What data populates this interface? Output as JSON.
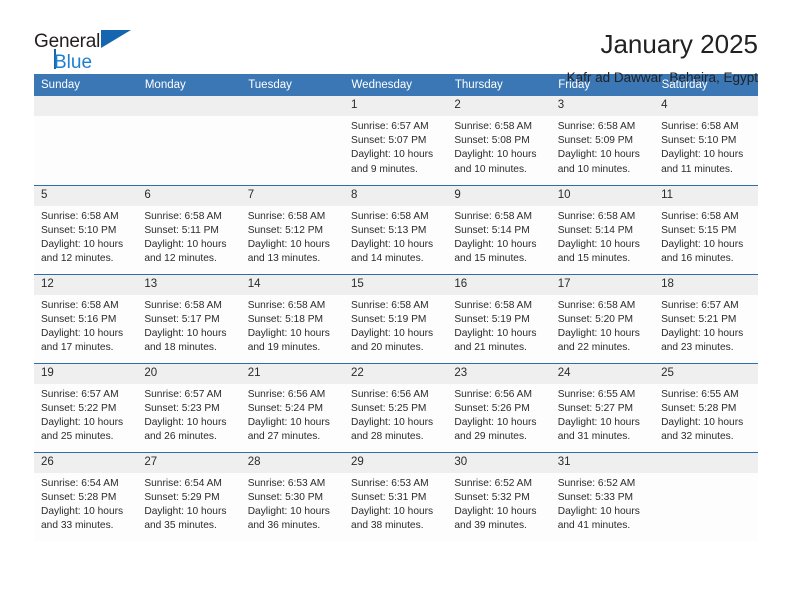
{
  "brand": {
    "line1": "General",
    "line2": "Blue",
    "triangle_color": "#1565b0",
    "blue_color": "#1d7fd0"
  },
  "header": {
    "title": "January 2025",
    "subtitle": "Kafr ad Dawwar, Beheira, Egypt",
    "header_bg": "#3b76b5",
    "daynum_bg": "#efefef"
  },
  "weekdays": [
    "Sunday",
    "Monday",
    "Tuesday",
    "Wednesday",
    "Thursday",
    "Friday",
    "Saturday"
  ],
  "weeks": [
    [
      {
        "day": "",
        "empty": true
      },
      {
        "day": "",
        "empty": true
      },
      {
        "day": "",
        "empty": true
      },
      {
        "day": "1",
        "sunrise": "Sunrise: 6:57 AM",
        "sunset": "Sunset: 5:07 PM",
        "daylight1": "Daylight: 10 hours",
        "daylight2": "and 9 minutes."
      },
      {
        "day": "2",
        "sunrise": "Sunrise: 6:58 AM",
        "sunset": "Sunset: 5:08 PM",
        "daylight1": "Daylight: 10 hours",
        "daylight2": "and 10 minutes."
      },
      {
        "day": "3",
        "sunrise": "Sunrise: 6:58 AM",
        "sunset": "Sunset: 5:09 PM",
        "daylight1": "Daylight: 10 hours",
        "daylight2": "and 10 minutes."
      },
      {
        "day": "4",
        "sunrise": "Sunrise: 6:58 AM",
        "sunset": "Sunset: 5:10 PM",
        "daylight1": "Daylight: 10 hours",
        "daylight2": "and 11 minutes."
      }
    ],
    [
      {
        "day": "5",
        "sunrise": "Sunrise: 6:58 AM",
        "sunset": "Sunset: 5:10 PM",
        "daylight1": "Daylight: 10 hours",
        "daylight2": "and 12 minutes."
      },
      {
        "day": "6",
        "sunrise": "Sunrise: 6:58 AM",
        "sunset": "Sunset: 5:11 PM",
        "daylight1": "Daylight: 10 hours",
        "daylight2": "and 12 minutes."
      },
      {
        "day": "7",
        "sunrise": "Sunrise: 6:58 AM",
        "sunset": "Sunset: 5:12 PM",
        "daylight1": "Daylight: 10 hours",
        "daylight2": "and 13 minutes."
      },
      {
        "day": "8",
        "sunrise": "Sunrise: 6:58 AM",
        "sunset": "Sunset: 5:13 PM",
        "daylight1": "Daylight: 10 hours",
        "daylight2": "and 14 minutes."
      },
      {
        "day": "9",
        "sunrise": "Sunrise: 6:58 AM",
        "sunset": "Sunset: 5:14 PM",
        "daylight1": "Daylight: 10 hours",
        "daylight2": "and 15 minutes."
      },
      {
        "day": "10",
        "sunrise": "Sunrise: 6:58 AM",
        "sunset": "Sunset: 5:14 PM",
        "daylight1": "Daylight: 10 hours",
        "daylight2": "and 15 minutes."
      },
      {
        "day": "11",
        "sunrise": "Sunrise: 6:58 AM",
        "sunset": "Sunset: 5:15 PM",
        "daylight1": "Daylight: 10 hours",
        "daylight2": "and 16 minutes."
      }
    ],
    [
      {
        "day": "12",
        "sunrise": "Sunrise: 6:58 AM",
        "sunset": "Sunset: 5:16 PM",
        "daylight1": "Daylight: 10 hours",
        "daylight2": "and 17 minutes."
      },
      {
        "day": "13",
        "sunrise": "Sunrise: 6:58 AM",
        "sunset": "Sunset: 5:17 PM",
        "daylight1": "Daylight: 10 hours",
        "daylight2": "and 18 minutes."
      },
      {
        "day": "14",
        "sunrise": "Sunrise: 6:58 AM",
        "sunset": "Sunset: 5:18 PM",
        "daylight1": "Daylight: 10 hours",
        "daylight2": "and 19 minutes."
      },
      {
        "day": "15",
        "sunrise": "Sunrise: 6:58 AM",
        "sunset": "Sunset: 5:19 PM",
        "daylight1": "Daylight: 10 hours",
        "daylight2": "and 20 minutes."
      },
      {
        "day": "16",
        "sunrise": "Sunrise: 6:58 AM",
        "sunset": "Sunset: 5:19 PM",
        "daylight1": "Daylight: 10 hours",
        "daylight2": "and 21 minutes."
      },
      {
        "day": "17",
        "sunrise": "Sunrise: 6:58 AM",
        "sunset": "Sunset: 5:20 PM",
        "daylight1": "Daylight: 10 hours",
        "daylight2": "and 22 minutes."
      },
      {
        "day": "18",
        "sunrise": "Sunrise: 6:57 AM",
        "sunset": "Sunset: 5:21 PM",
        "daylight1": "Daylight: 10 hours",
        "daylight2": "and 23 minutes."
      }
    ],
    [
      {
        "day": "19",
        "sunrise": "Sunrise: 6:57 AM",
        "sunset": "Sunset: 5:22 PM",
        "daylight1": "Daylight: 10 hours",
        "daylight2": "and 25 minutes."
      },
      {
        "day": "20",
        "sunrise": "Sunrise: 6:57 AM",
        "sunset": "Sunset: 5:23 PM",
        "daylight1": "Daylight: 10 hours",
        "daylight2": "and 26 minutes."
      },
      {
        "day": "21",
        "sunrise": "Sunrise: 6:56 AM",
        "sunset": "Sunset: 5:24 PM",
        "daylight1": "Daylight: 10 hours",
        "daylight2": "and 27 minutes."
      },
      {
        "day": "22",
        "sunrise": "Sunrise: 6:56 AM",
        "sunset": "Sunset: 5:25 PM",
        "daylight1": "Daylight: 10 hours",
        "daylight2": "and 28 minutes."
      },
      {
        "day": "23",
        "sunrise": "Sunrise: 6:56 AM",
        "sunset": "Sunset: 5:26 PM",
        "daylight1": "Daylight: 10 hours",
        "daylight2": "and 29 minutes."
      },
      {
        "day": "24",
        "sunrise": "Sunrise: 6:55 AM",
        "sunset": "Sunset: 5:27 PM",
        "daylight1": "Daylight: 10 hours",
        "daylight2": "and 31 minutes."
      },
      {
        "day": "25",
        "sunrise": "Sunrise: 6:55 AM",
        "sunset": "Sunset: 5:28 PM",
        "daylight1": "Daylight: 10 hours",
        "daylight2": "and 32 minutes."
      }
    ],
    [
      {
        "day": "26",
        "sunrise": "Sunrise: 6:54 AM",
        "sunset": "Sunset: 5:28 PM",
        "daylight1": "Daylight: 10 hours",
        "daylight2": "and 33 minutes."
      },
      {
        "day": "27",
        "sunrise": "Sunrise: 6:54 AM",
        "sunset": "Sunset: 5:29 PM",
        "daylight1": "Daylight: 10 hours",
        "daylight2": "and 35 minutes."
      },
      {
        "day": "28",
        "sunrise": "Sunrise: 6:53 AM",
        "sunset": "Sunset: 5:30 PM",
        "daylight1": "Daylight: 10 hours",
        "daylight2": "and 36 minutes."
      },
      {
        "day": "29",
        "sunrise": "Sunrise: 6:53 AM",
        "sunset": "Sunset: 5:31 PM",
        "daylight1": "Daylight: 10 hours",
        "daylight2": "and 38 minutes."
      },
      {
        "day": "30",
        "sunrise": "Sunrise: 6:52 AM",
        "sunset": "Sunset: 5:32 PM",
        "daylight1": "Daylight: 10 hours",
        "daylight2": "and 39 minutes."
      },
      {
        "day": "31",
        "sunrise": "Sunrise: 6:52 AM",
        "sunset": "Sunset: 5:33 PM",
        "daylight1": "Daylight: 10 hours",
        "daylight2": "and 41 minutes."
      },
      {
        "day": "",
        "empty": true
      }
    ]
  ]
}
